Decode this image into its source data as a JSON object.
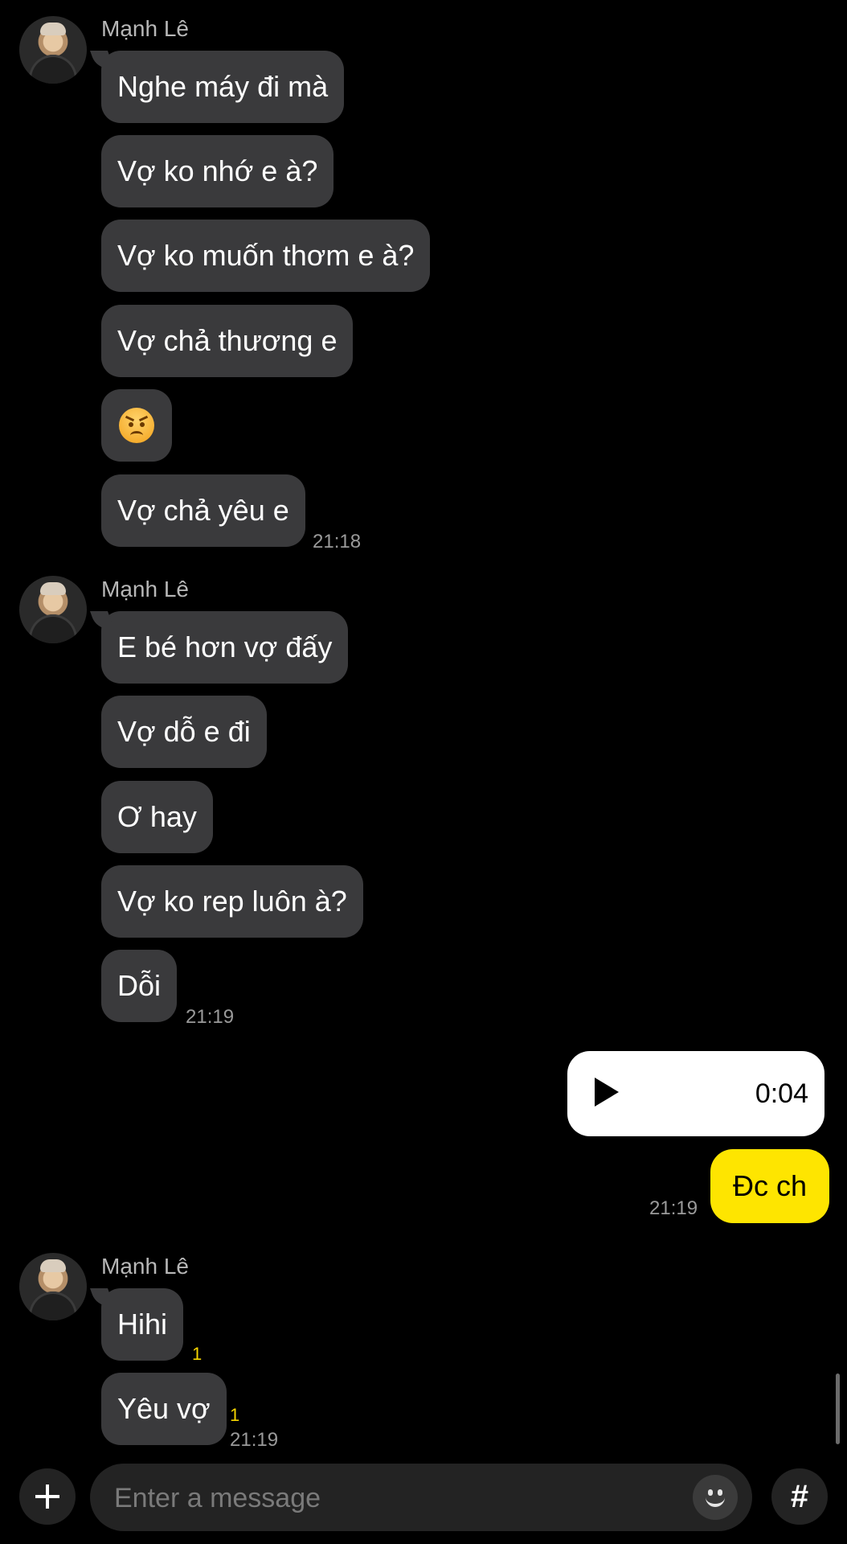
{
  "chat": {
    "groups": [
      {
        "sender": "Mạnh Lê",
        "messages": [
          "Nghe máy đi mà",
          "Vợ ko nhớ e à?",
          "Vợ ko muốn thơm e à?",
          "Vợ chả thương e",
          "",
          "Vợ chả yêu e"
        ],
        "time": "21:18"
      },
      {
        "sender": "Mạnh Lê",
        "messages": [
          "E bé hơn vợ đấy",
          "Vợ dỗ e đi",
          "Ơ hay",
          "Vợ ko rep luôn à?",
          "Dỗi"
        ],
        "time": "21:19"
      },
      {
        "sender": "Mạnh Lê",
        "messages": [
          "Hihi",
          "Yêu vợ"
        ],
        "unread": [
          "1",
          "1"
        ],
        "time": "21:19"
      }
    ],
    "emoji_message_icon": "angry-face-emoji",
    "outgoing": {
      "voice_duration": "0:04",
      "text": "Đc ch",
      "time": "21:19"
    }
  },
  "composer": {
    "placeholder": "Enter a message",
    "plus_icon": "plus-icon",
    "emoji_icon": "smiley-icon",
    "hash_icon": "hashtag-icon",
    "hash_label": "#"
  },
  "colors": {
    "background": "#000000",
    "incoming_bubble": "#3a3a3c",
    "outgoing_bubble": "#fee500",
    "unread_count": "#f5d400"
  }
}
